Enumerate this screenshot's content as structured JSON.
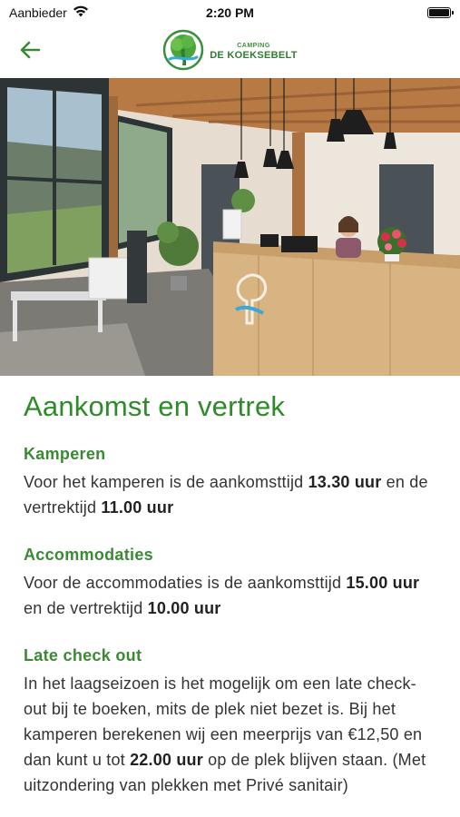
{
  "status_bar": {
    "carrier": "Aanbieder",
    "time": "2:20 PM",
    "wifi_icon": "wifi-icon",
    "battery_level": 1.0
  },
  "nav": {
    "back_icon": "arrow-left-icon",
    "logo_small": "CAMPING",
    "logo_big": "DE KOEKSEBELT",
    "brand_color": "#2f8a2a"
  },
  "page": {
    "title": "Aankomst en vertrek"
  },
  "sections": [
    {
      "heading": "Kamperen",
      "body_parts": [
        {
          "t": "Voor het kamperen is de aankomsttijd ",
          "b": false
        },
        {
          "t": "13.30 uur",
          "b": true
        },
        {
          "t": " en de vertrektijd ",
          "b": false
        },
        {
          "t": "11.00 uur",
          "b": true
        }
      ]
    },
    {
      "heading": "Accommodaties",
      "body_parts": [
        {
          "t": "Voor de accommodaties is de aankomsttijd ",
          "b": false
        },
        {
          "t": "15.00 uur",
          "b": true
        },
        {
          "t": " en de vertrektijd ",
          "b": false
        },
        {
          "t": "10.00 uur",
          "b": true
        }
      ]
    },
    {
      "heading": "Late check out",
      "body_parts": [
        {
          "t": "In het laagseizoen is het mogelijk om een late check-out bij te boeken, mits de plek niet bezet is. Bij het kamperen berekenen wij een meerprijs van €12,50 en dan kunt u tot ",
          "b": false
        },
        {
          "t": "22.00 uur",
          "b": true
        },
        {
          "t": " op de plek blijven staan. (Met uitzondering van plekken met Privé sanitair)",
          "b": false
        }
      ]
    }
  ]
}
